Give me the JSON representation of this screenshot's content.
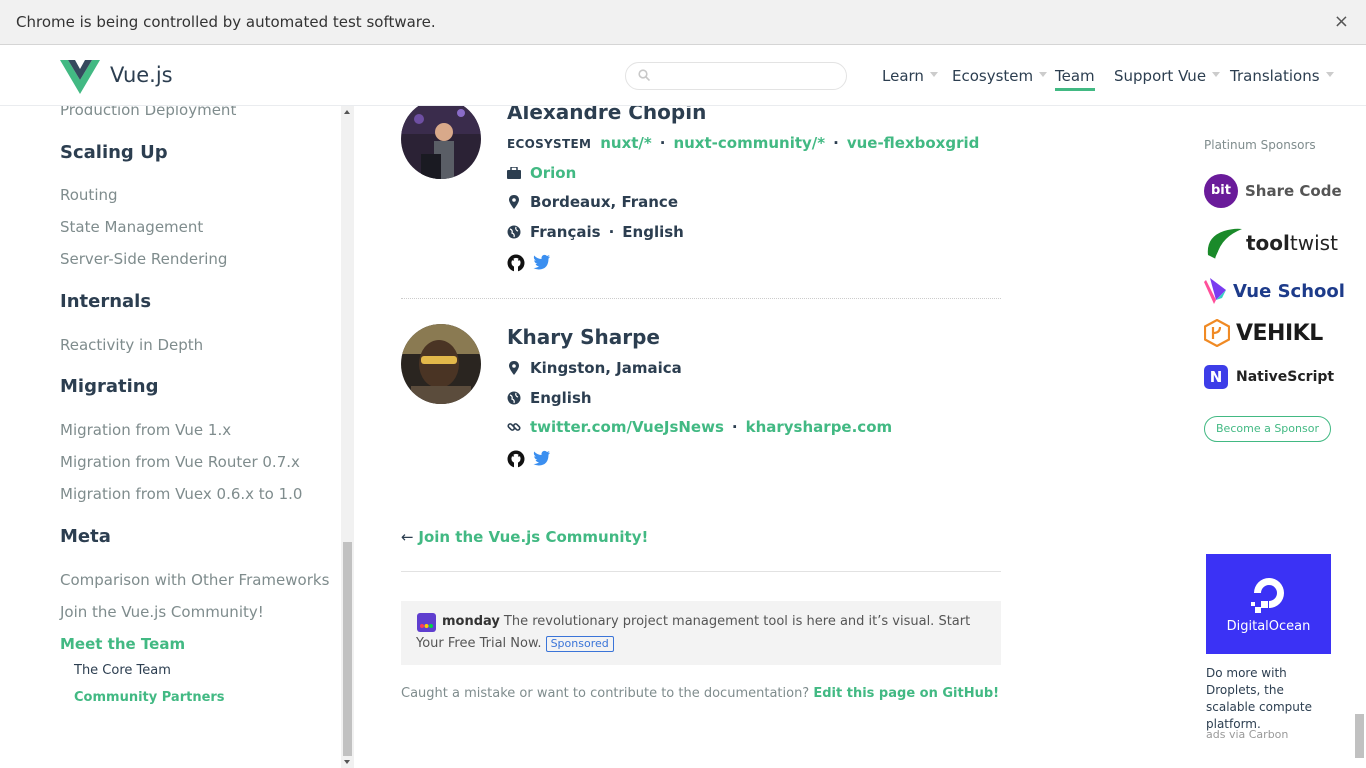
{
  "infobar": {
    "text": "Chrome is being controlled by automated test software.",
    "close": "×"
  },
  "header": {
    "brand": "Vue.js",
    "search_placeholder": "",
    "nav": [
      {
        "label": "Learn",
        "dropdown": true
      },
      {
        "label": "Ecosystem",
        "dropdown": true
      },
      {
        "label": "Team",
        "active": true
      },
      {
        "label": "Support Vue",
        "dropdown": true
      },
      {
        "label": "Translations",
        "dropdown": true
      }
    ]
  },
  "sidebar": {
    "top_link": "Production Deployment",
    "scaling_up": {
      "heading": "Scaling Up",
      "items": [
        "Routing",
        "State Management",
        "Server-Side Rendering"
      ]
    },
    "internals": {
      "heading": "Internals",
      "items": [
        "Reactivity in Depth"
      ]
    },
    "migrating": {
      "heading": "Migrating",
      "items": [
        "Migration from Vue 1.x",
        "Migration from Vue Router 0.7.x",
        "Migration from Vuex 0.6.x to 1.0"
      ]
    },
    "meta": {
      "heading": "Meta",
      "items": [
        "Comparison with Other Frameworks",
        "Join the Vue.js Community!",
        "Meet the Team"
      ]
    },
    "sub": [
      "The Core Team",
      "Community Partners"
    ]
  },
  "members": [
    {
      "name": "Alexandre Chopin",
      "ecosystem_label": "ECOSYSTEM",
      "ecosystem": [
        "nuxt/*",
        "nuxt-community/*",
        "vue-flexboxgrid"
      ],
      "work": "Orion",
      "location": "Bordeaux, France",
      "languages": [
        "Français",
        "English"
      ]
    },
    {
      "name": "Khary Sharpe",
      "location": "Kingston, Jamaica",
      "languages": [
        "English"
      ],
      "links": [
        "twitter.com/VueJsNews",
        "kharysharpe.com"
      ]
    }
  ],
  "separator": "·",
  "join": {
    "arrow": "←",
    "label": "Join the Vue.js Community!"
  },
  "ad": {
    "brand": "monday",
    "text": "The revolutionary project management tool is here and it’s visual. Start Your Free Trial Now.",
    "badge": "Sponsored"
  },
  "contribute": {
    "text": "Caught a mistake or want to contribute to the documentation?",
    "link": "Edit this page on GitHub!"
  },
  "sponsors": {
    "title": "Platinum Sponsors",
    "items": [
      {
        "badge": "bit",
        "name": "Share Code",
        "color": "#6a1b9a"
      },
      {
        "name_a": "tool",
        "name_b": "twist",
        "color": "#1a8a2a"
      },
      {
        "name": "Vue School",
        "color": "#1d3b8a"
      },
      {
        "name": "VEHIKL",
        "color": "#1a1a1a"
      },
      {
        "badge": "N",
        "name": "NativeScript",
        "color": "#3d3de8"
      }
    ],
    "become": "Become a Sponsor"
  },
  "carbon": {
    "label": "DigitalOcean",
    "desc": "Do more with Droplets, the scalable compute platform.",
    "via": "ads via Carbon"
  }
}
